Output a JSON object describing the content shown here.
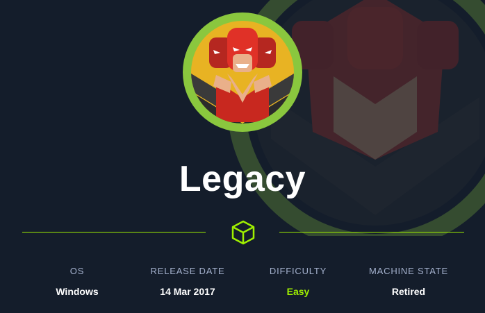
{
  "machine": {
    "name": "Legacy"
  },
  "info": [
    {
      "label": "OS",
      "value": "Windows"
    },
    {
      "label": "RELEASE DATE",
      "value": "14 Mar 2017"
    },
    {
      "label": "DIFFICULTY",
      "value": "Easy"
    },
    {
      "label": "MACHINE STATE",
      "value": "Retired"
    }
  ],
  "colors": {
    "background": "#141d2b",
    "accent": "#9fef00",
    "label": "#a4b1cd",
    "avatar_ring": "#8ac73e"
  },
  "icons": {
    "divider": "cube-icon",
    "avatar": "machine-avatar"
  }
}
